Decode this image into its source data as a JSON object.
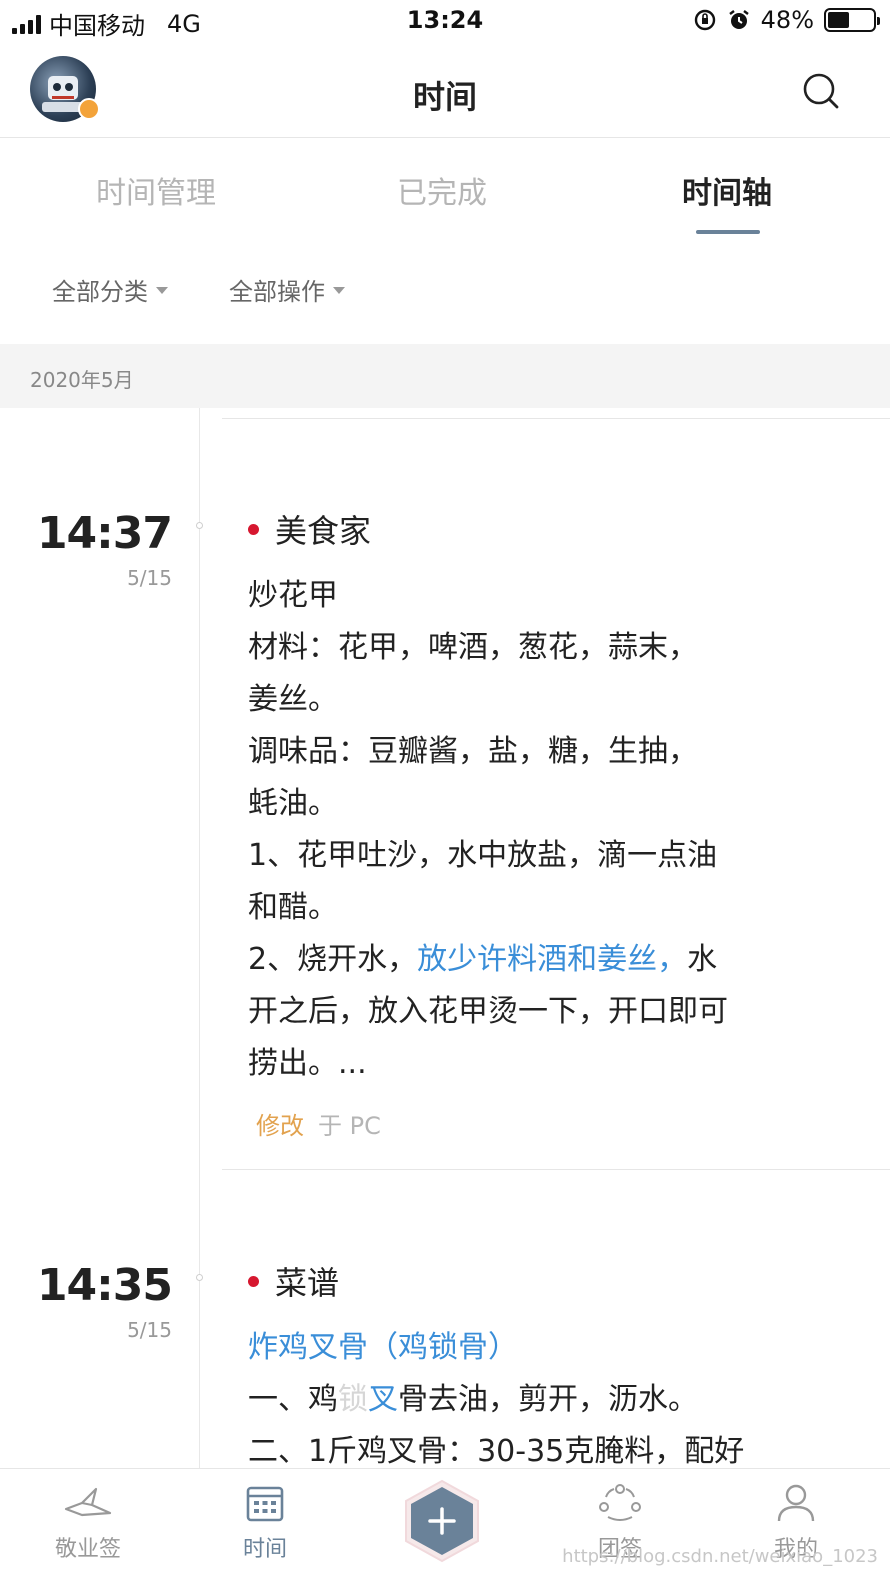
{
  "status_bar": {
    "carrier": "中国移动",
    "network": "4G",
    "time": "13:24",
    "battery": "48%",
    "battery_level": 0.48
  },
  "header": {
    "title": "时间",
    "avatar_icon": "avatar-icon",
    "search_icon": "search-icon"
  },
  "tabs": [
    {
      "label": "时间管理",
      "active": false
    },
    {
      "label": "已完成",
      "active": false
    },
    {
      "label": "时间轴",
      "active": true
    }
  ],
  "filters": {
    "category": "全部分类",
    "operation": "全部操作"
  },
  "month": "2020年5月",
  "entries": [
    {
      "time": "14:37",
      "date": "5/15",
      "category": "美食家",
      "lines": [
        "炒花甲",
        "材料：花甲，啤酒，葱花，蒜末，",
        "姜丝。",
        "调味品：豆瓣酱，盐，糖，生抽，",
        "蚝油。",
        "1、花甲吐沙，水中放盐，滴一点油",
        "和醋。"
      ],
      "line8_prefix": "2、烧开水，",
      "line8_highlight": "放少许料酒和姜丝，",
      "line8_suffix": "水",
      "line9": "开之后，放入花甲烫一下，开口即可",
      "line10": "捞出。...",
      "modified_label": "修改",
      "via_label": "于 PC"
    },
    {
      "time": "14:35",
      "date": "5/15",
      "category": "菜谱",
      "title": "炸鸡叉骨（鸡锁骨）",
      "line2_a": "一、鸡",
      "line2_faded": "锁",
      "line2_blue": "叉",
      "line2_b": "骨去油，剪开，沥水。",
      "line3": "二、1斤鸡叉骨：30-35克腌料，配好"
    }
  ],
  "bottom_nav": [
    {
      "label": "敬业签",
      "icon": "paper-plane-icon",
      "active": false
    },
    {
      "label": "时间",
      "icon": "calendar-icon",
      "active": true
    },
    {
      "label": "",
      "icon": "plus-icon",
      "active": false
    },
    {
      "label": "团签",
      "icon": "team-icon",
      "active": false
    },
    {
      "label": "我的",
      "icon": "person-icon",
      "active": false
    }
  ],
  "watermark": "https://blog.csdn.net/weixiao_1023",
  "colors": {
    "accent": "#6a8299",
    "category_dot": "#d6172f",
    "highlight_text": "#3a8ed8",
    "modified_text": "#e2a24e"
  }
}
